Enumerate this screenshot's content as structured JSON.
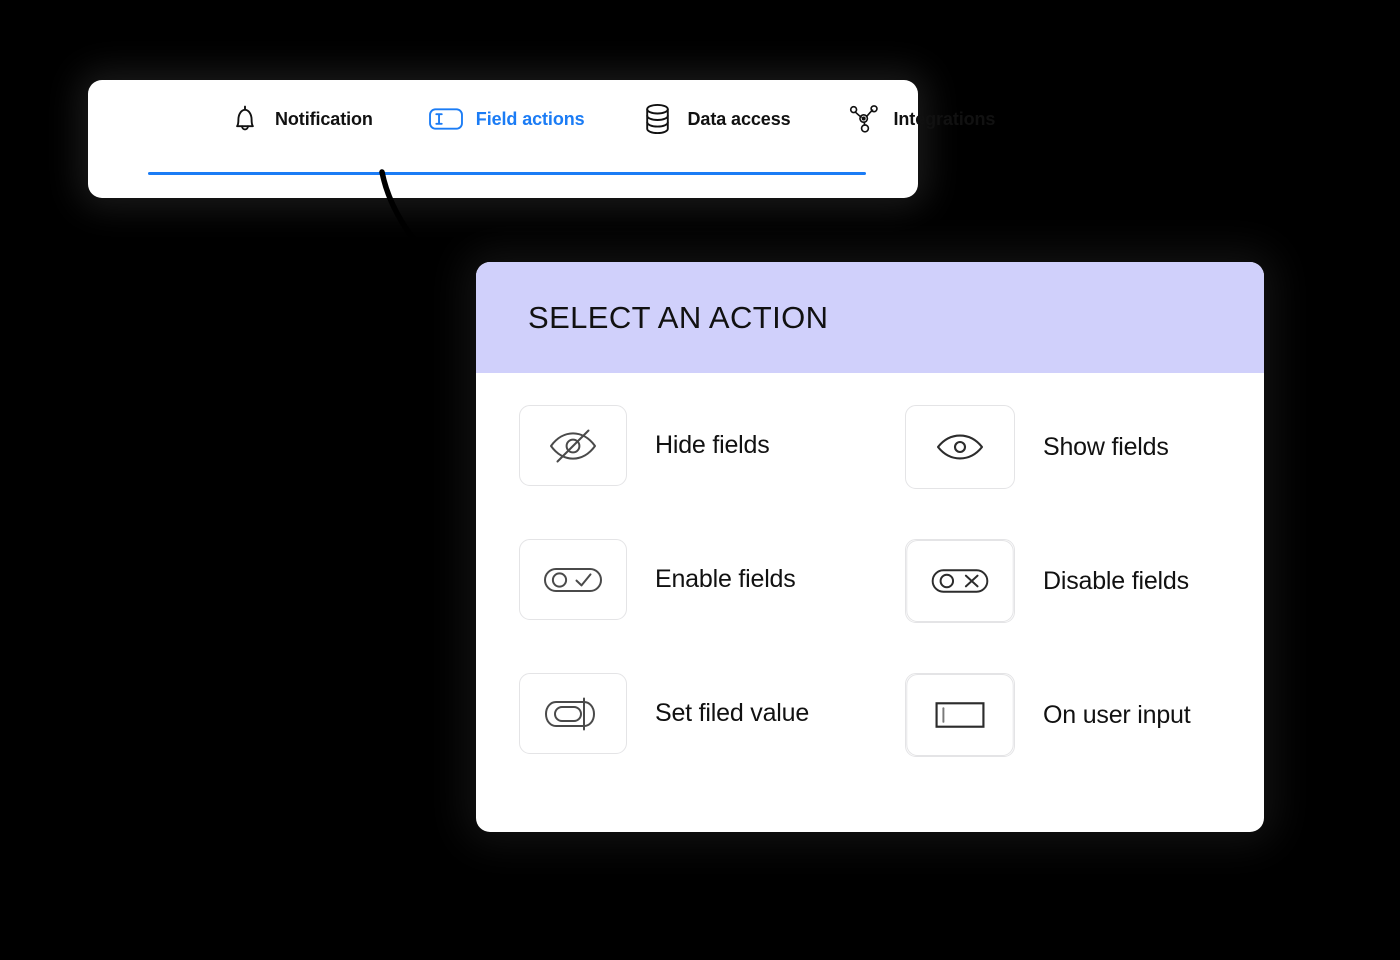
{
  "toolbar": {
    "tabs": [
      {
        "label": "Notification",
        "icon": "bell-icon",
        "active": false
      },
      {
        "label": "Field actions",
        "icon": "text-field-icon",
        "active": true
      },
      {
        "label": "Data access",
        "icon": "database-icon",
        "active": false
      },
      {
        "label": "Integrations",
        "icon": "node-graph-icon",
        "active": false
      }
    ],
    "active_tab": "Field actions",
    "accent_color": "#1b7cf5"
  },
  "modal": {
    "title": "SELECT AN ACTION",
    "header_color": "#d0d0fb",
    "actions": [
      {
        "label": "Hide fields",
        "icon": "eye-off-icon"
      },
      {
        "label": "Show fields",
        "icon": "eye-icon"
      },
      {
        "label": "Enable fields",
        "icon": "toggle-check-icon"
      },
      {
        "label": "Disable fields",
        "icon": "toggle-x-icon"
      },
      {
        "label": "Set filed value",
        "icon": "set-value-icon"
      },
      {
        "label": "On user input",
        "icon": "text-input-icon"
      }
    ]
  },
  "connector": {
    "icon": "curved-arrow-icon"
  }
}
